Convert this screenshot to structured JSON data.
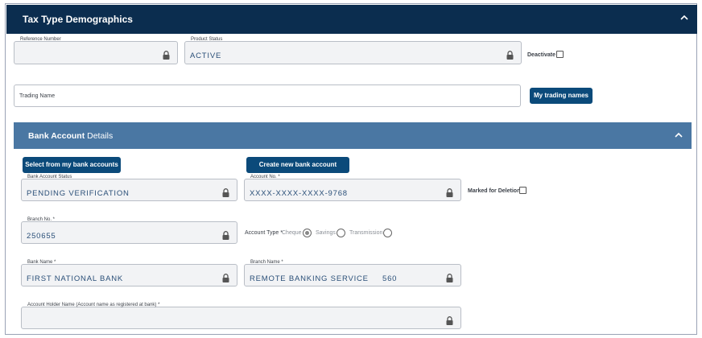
{
  "header": {
    "title": "Tax Type Demographics"
  },
  "reference_number": {
    "label": "Reference Number",
    "value": ""
  },
  "product_status": {
    "label": "Product Status",
    "value": "ACTIVE"
  },
  "deactivate": {
    "label": "Deactivate",
    "checked": false
  },
  "trading_name": {
    "label": "Trading Name",
    "value": ""
  },
  "my_trading_names_button": "My trading names",
  "bank_section": {
    "title_bold": "Bank Account",
    "title_rest": " Details"
  },
  "buttons": {
    "select_from_accounts": "Select from my bank accounts",
    "create_new_account": "Create new bank account"
  },
  "bank_account_status": {
    "label": "Bank Account Status",
    "value": "PENDING VERIFICATION"
  },
  "account_no": {
    "label": "Account No. *",
    "value": "XXXX-XXXX-XXXX-9768"
  },
  "marked_for_deletion": {
    "label": "Marked for Deletion",
    "checked": false
  },
  "branch_no": {
    "label": "Branch No. *",
    "value": "250655"
  },
  "account_type": {
    "label": "Account Type *",
    "options": [
      "Cheque",
      "Savings",
      "Transmission"
    ],
    "selected": "Cheque"
  },
  "bank_name": {
    "label": "Bank Name *",
    "value": "FIRST NATIONAL BANK"
  },
  "branch_name": {
    "label": "Branch Name *",
    "value": "REMOTE BANKING SERVICE     560"
  },
  "account_holder_name": {
    "label": "Account Holder Name (Account name as registered at bank) *",
    "value": ""
  },
  "icons": {
    "lock": "lock-icon",
    "collapse": "chevron-up-icon"
  },
  "colors": {
    "header_dark": "#0b2d4f",
    "section_header": "#4a77a3",
    "button": "#0b4a7a",
    "value_text": "#2a4f78"
  }
}
